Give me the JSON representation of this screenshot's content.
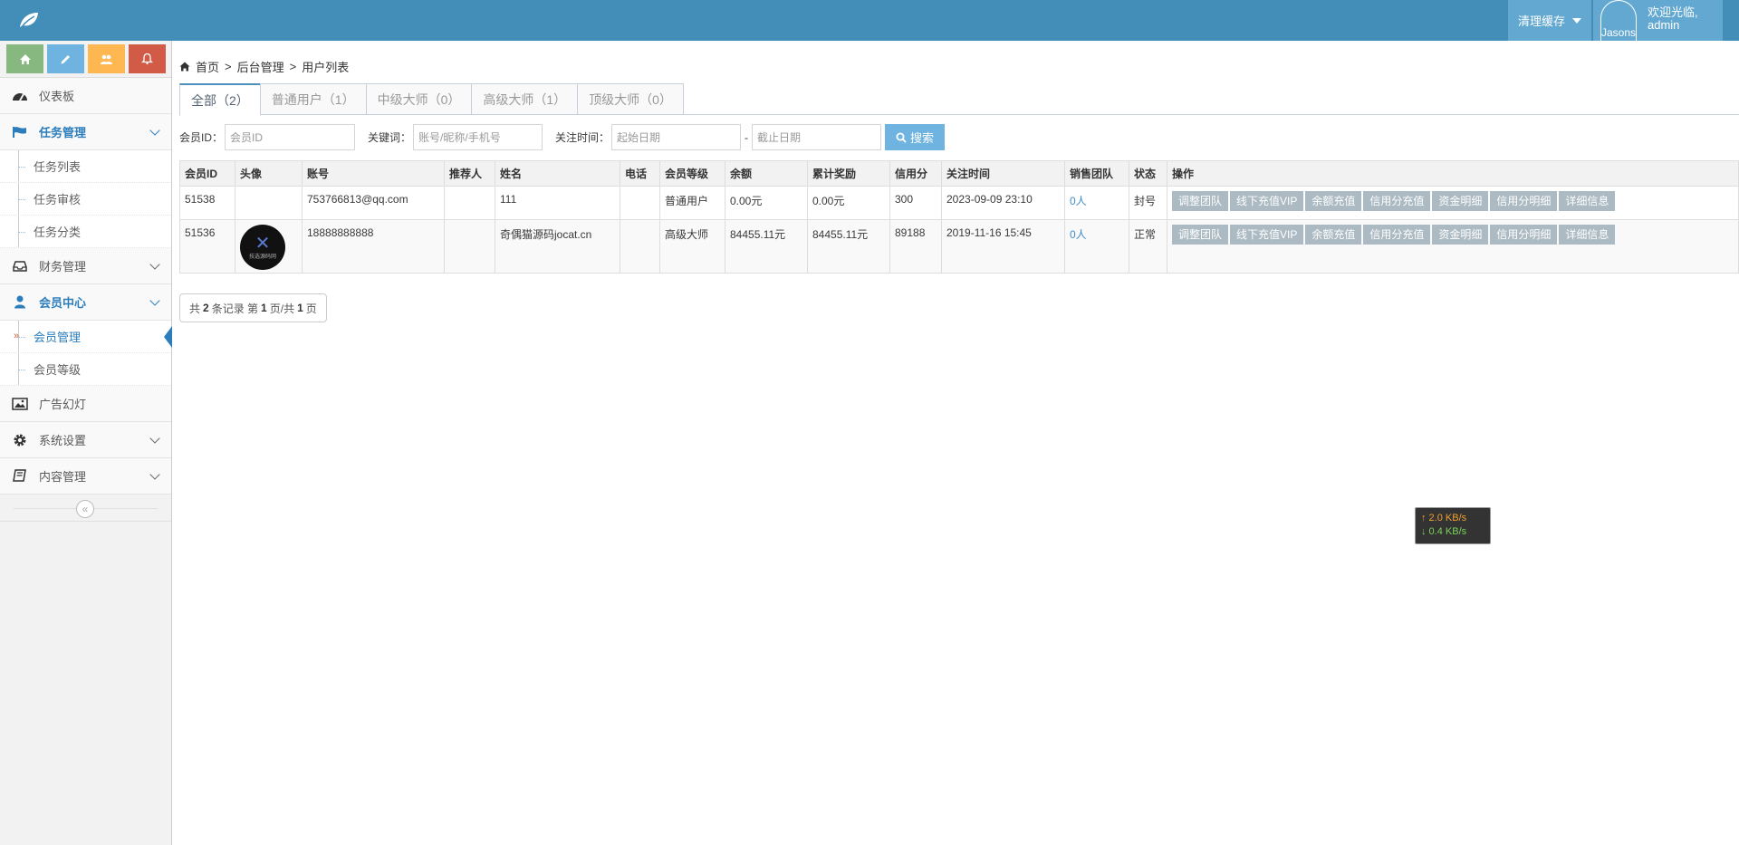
{
  "header": {
    "clear_cache": "清理缓存",
    "avatar_alt": "Jasons",
    "welcome_line1": "欢迎光临,",
    "welcome_line2": "admin"
  },
  "sidebar": {
    "items": [
      {
        "label": "仪表板"
      },
      {
        "label": "任务管理",
        "subs": [
          "任务列表",
          "任务审核",
          "任务分类"
        ]
      },
      {
        "label": "财务管理"
      },
      {
        "label": "会员中心",
        "subs": [
          "会员管理",
          "会员等级"
        ]
      },
      {
        "label": "广告幻灯"
      },
      {
        "label": "系统设置"
      },
      {
        "label": "内容管理"
      }
    ],
    "collapse_glyph": "«"
  },
  "breadcrumb": {
    "home": "首页",
    "sep": ">",
    "level2": "后台管理",
    "level3": "用户列表"
  },
  "tabs": [
    "全部（2）",
    "普通用户（1）",
    "中级大师（0）",
    "高级大师（1）",
    "顶级大师（0）"
  ],
  "search": {
    "member_id_label": "会员ID：",
    "member_id_placeholder": "会员ID",
    "keyword_label": "关键词：",
    "keyword_placeholder": "账号/昵称/手机号",
    "time_label": "关注时间：",
    "start_placeholder": "起始日期",
    "dash": "-",
    "end_placeholder": "截止日期",
    "search_label": "搜索"
  },
  "table": {
    "headers": [
      "会员ID",
      "头像",
      "账号",
      "推荐人",
      "姓名",
      "电话",
      "会员等级",
      "余额",
      "累计奖励",
      "信用分",
      "关注时间",
      "销售团队",
      "状态",
      "操作"
    ],
    "rows": [
      {
        "id": "51538",
        "account": "753766813@qq.com",
        "referrer": "",
        "name": "111",
        "phone": "",
        "level": "普通用户",
        "balance": "0.00元",
        "reward": "0.00元",
        "credit": "300",
        "time": "2023-09-09 23:10",
        "team": "0人",
        "status": "封号"
      },
      {
        "id": "51536",
        "account": "18888888888",
        "referrer": "",
        "name": "奇偶猫源码jocat.cn",
        "phone": "",
        "level": "高级大师",
        "balance": "84455.11元",
        "reward": "84455.11元",
        "credit": "89188",
        "time": "2019-11-16 15:45",
        "team": "0人",
        "status": "正常",
        "avatar_text": "技选源码网"
      }
    ],
    "actions": [
      "调整团队",
      "线下充值VIP",
      "余额充值",
      "信用分充值",
      "资金明细",
      "信用分明细",
      "详细信息"
    ]
  },
  "pager": {
    "prefix": "共",
    "total": "2",
    "mid1": "条记录 第",
    "page": "1",
    "mid2": "页/共",
    "pages": "1",
    "suffix": "页"
  },
  "netspeed": {
    "up": "↑ 2.0 KB/s",
    "down": "↓ 0.4 KB/s"
  },
  "colors": {
    "navbar": "#438eb9",
    "accent": "#2b7dbc",
    "action_button": "#abbac3",
    "search_button": "#6fb3e0"
  }
}
